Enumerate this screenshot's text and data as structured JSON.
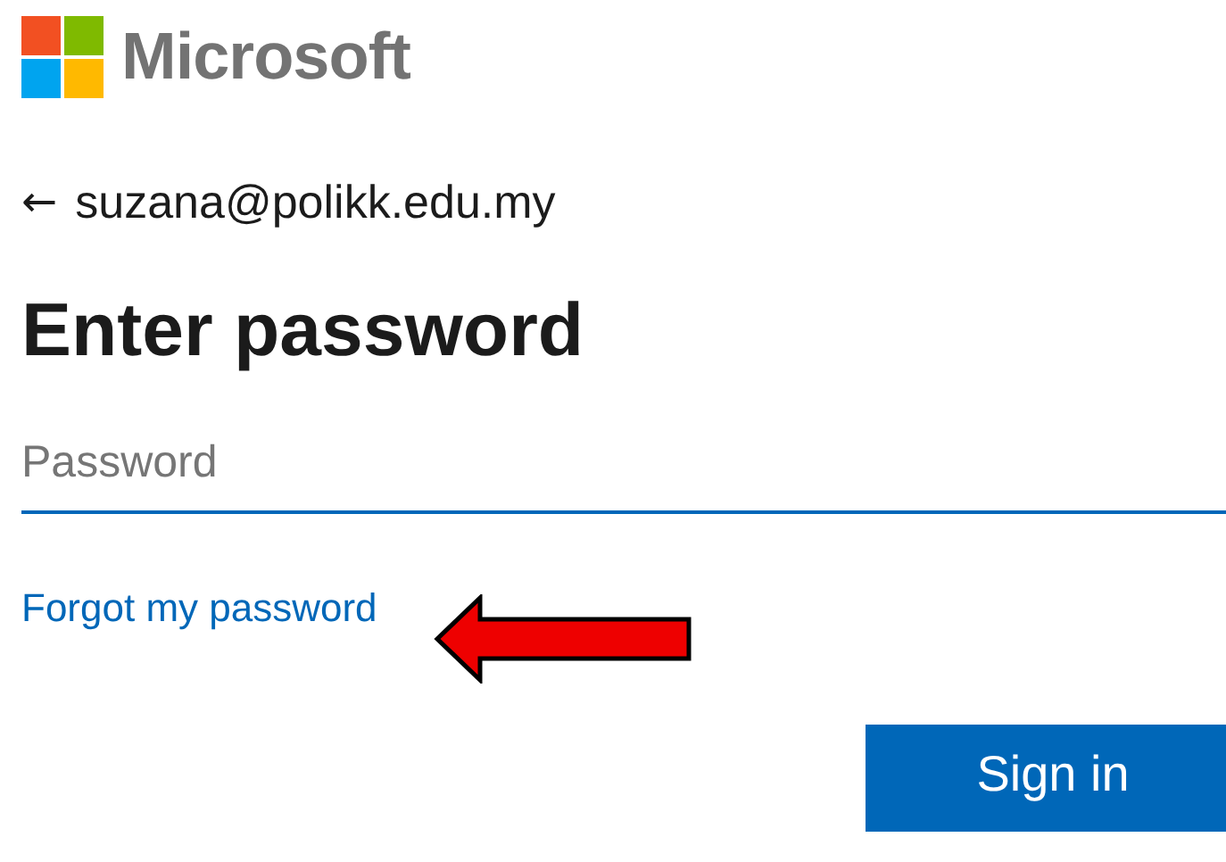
{
  "brand": {
    "name": "Microsoft"
  },
  "account": {
    "back": "←",
    "email": "suzana@polikk.edu.my"
  },
  "heading": "Enter password",
  "password_field": {
    "placeholder": "Password",
    "focused": true
  },
  "forgot_link": "Forgot my password",
  "buttons": [
    {
      "kind": "primary",
      "label": "Sign in"
    }
  ]
}
